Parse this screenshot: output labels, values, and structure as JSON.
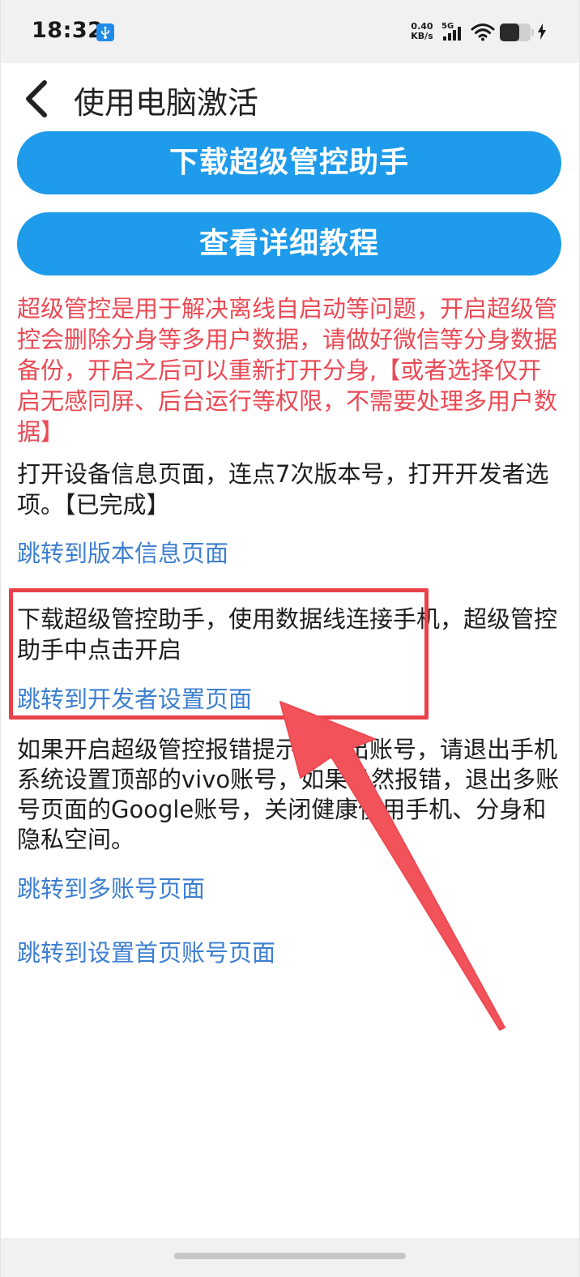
{
  "status_bar": {
    "time": "18:32",
    "net_speed_value": "0.40",
    "net_speed_unit": "KB/s",
    "network_type": "5G",
    "icons": [
      "usb-debug-icon",
      "signal-icon",
      "wifi-icon",
      "battery-icon",
      "charging-icon"
    ]
  },
  "header": {
    "title": "使用电脑激活",
    "back_icon": "chevron-left"
  },
  "buttons": {
    "download": "下载超级管控助手",
    "tutorial": "查看详细教程"
  },
  "warning": "超级管控是用于解决离线自启动等问题，开启超级管控会删除分身等多用户数据，请做好微信等分身数据备份，开启之后可以重新打开分身,【或者选择仅开启无感同屏、后台运行等权限，不需要处理多用户数据】",
  "steps": [
    {
      "text": "打开设备信息页面，连点7次版本号，打开开发者选项。【已完成】",
      "link": "跳转到版本信息页面"
    },
    {
      "text": "下载超级管控助手，使用数据线连接手机，超级管控助手中点击开启",
      "link": "跳转到开发者设置页面"
    },
    {
      "text": "如果开启超级管控报错提示请退出账号，请退出手机系统设置顶部的vivo账号，如果仍然报错，退出多账号页面的Google账号，关闭健康使用手机、分身和隐私空间。",
      "link": "跳转到多账号页面",
      "link2": "跳转到设置首页账号页面"
    }
  ],
  "colors": {
    "primary_button": "#1e9bea",
    "warning_text": "#ea4a55",
    "link_text": "#3d7fd0",
    "annotation_red": "#e9414a",
    "arrow_red": "#f2525a"
  }
}
